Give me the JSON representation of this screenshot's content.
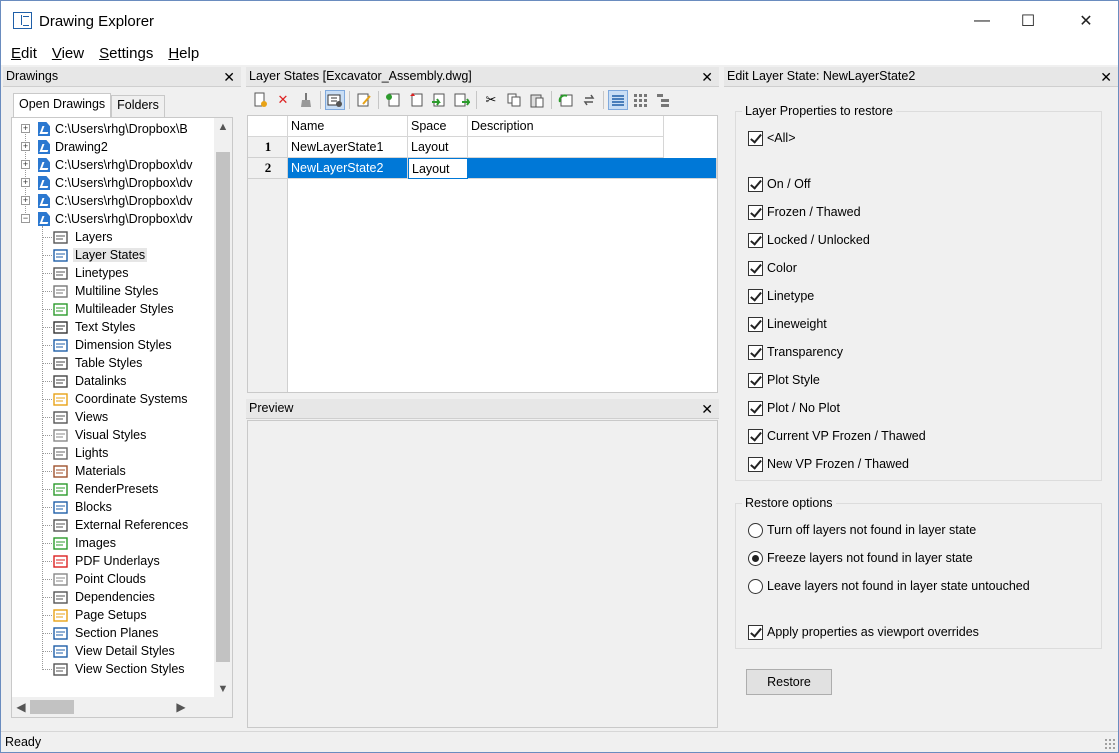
{
  "window": {
    "title": "Drawing Explorer",
    "minimize": "—",
    "maximize": "☐",
    "close": "✕"
  },
  "menu": [
    {
      "label": "Edit",
      "underline": "E",
      "rest": "dit"
    },
    {
      "label": "View",
      "underline": "V",
      "rest": "iew"
    },
    {
      "label": "Settings",
      "underline": "S",
      "rest": "ettings"
    },
    {
      "label": "Help",
      "underline": "H",
      "rest": "elp"
    }
  ],
  "drawings_panel": {
    "title": "Drawings",
    "tabs": [
      "Open Drawings",
      "Folders"
    ],
    "active_tab": "Open Drawings",
    "drawings": [
      "C:\\Users\\rhg\\Dropbox\\B",
      "Drawing2",
      "C:\\Users\\rhg\\Dropbox\\dv",
      "C:\\Users\\rhg\\Dropbox\\dv",
      "C:\\Users\\rhg\\Dropbox\\dv",
      "C:\\Users\\rhg\\Dropbox\\dv"
    ],
    "nodes": [
      {
        "label": "Layers",
        "icon": "layers-icon"
      },
      {
        "label": "Layer States",
        "icon": "layer-states-icon",
        "selected": true
      },
      {
        "label": "Linetypes",
        "icon": "linetypes-icon"
      },
      {
        "label": "Multiline Styles",
        "icon": "multiline-styles-icon"
      },
      {
        "label": "Multileader Styles",
        "icon": "multileader-styles-icon"
      },
      {
        "label": "Text Styles",
        "icon": "text-styles-icon"
      },
      {
        "label": "Dimension Styles",
        "icon": "dimension-styles-icon"
      },
      {
        "label": "Table Styles",
        "icon": "table-styles-icon"
      },
      {
        "label": "Datalinks",
        "icon": "datalinks-icon"
      },
      {
        "label": "Coordinate Systems",
        "icon": "coordinate-systems-icon"
      },
      {
        "label": "Views",
        "icon": "views-icon"
      },
      {
        "label": "Visual Styles",
        "icon": "visual-styles-icon"
      },
      {
        "label": "Lights",
        "icon": "lights-icon"
      },
      {
        "label": "Materials",
        "icon": "materials-icon"
      },
      {
        "label": "RenderPresets",
        "icon": "render-presets-icon"
      },
      {
        "label": "Blocks",
        "icon": "blocks-icon"
      },
      {
        "label": "External References",
        "icon": "external-references-icon"
      },
      {
        "label": "Images",
        "icon": "images-icon"
      },
      {
        "label": "PDF Underlays",
        "icon": "pdf-underlays-icon"
      },
      {
        "label": "Point Clouds",
        "icon": "point-clouds-icon"
      },
      {
        "label": "Dependencies",
        "icon": "dependencies-icon"
      },
      {
        "label": "Page Setups",
        "icon": "page-setups-icon"
      },
      {
        "label": "Section Planes",
        "icon": "section-planes-icon"
      },
      {
        "label": "View Detail Styles",
        "icon": "view-detail-styles-icon"
      },
      {
        "label": "View Section Styles",
        "icon": "view-section-styles-icon"
      }
    ]
  },
  "layer_states_panel": {
    "title": "Layer States [Excavator_Assembly.dwg]",
    "columns": [
      "Name",
      "Space",
      "Description"
    ],
    "rows": [
      {
        "num": "1",
        "name": "NewLayerState1",
        "space": "Layout",
        "description": ""
      },
      {
        "num": "2",
        "name": "NewLayerState2",
        "space": "Layout",
        "description": ""
      }
    ],
    "selected_row": 2
  },
  "preview_panel": {
    "title": "Preview"
  },
  "edit_panel": {
    "title": "Edit Layer State: NewLayerState2",
    "properties_group": "Layer Properties to restore",
    "all_label": "<All>",
    "properties": [
      "On / Off",
      "Frozen / Thawed",
      "Locked / Unlocked",
      "Color",
      "Linetype",
      "Lineweight",
      "Transparency",
      "Plot Style",
      "Plot / No Plot",
      "Current VP Frozen / Thawed",
      "New VP Frozen / Thawed"
    ],
    "restore_group": "Restore options",
    "restore_options": [
      {
        "label": "Turn off layers not found in layer state",
        "selected": false
      },
      {
        "label": "Freeze layers not found in layer state",
        "selected": true
      },
      {
        "label": "Leave layers not found in layer state untouched",
        "selected": false
      }
    ],
    "viewport_override_label": "Apply properties as viewport overrides",
    "restore_button": "Restore"
  },
  "status": {
    "text": "Ready"
  },
  "colors": {
    "selection": "#0078d7",
    "file_icon": "#2b78d0"
  }
}
